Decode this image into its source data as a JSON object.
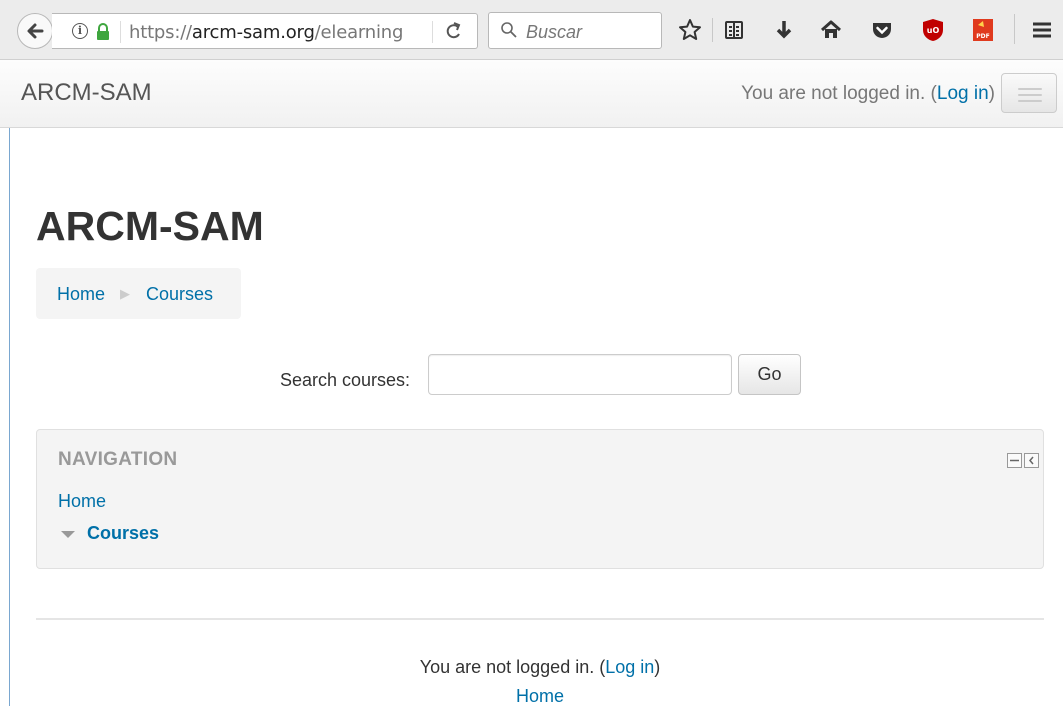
{
  "browser": {
    "url_prefix": "https://",
    "url_domain": "arcm-sam.org",
    "url_path": "/elearning",
    "search_placeholder": "Buscar",
    "pdf_label": "PDF",
    "ublock_label": "uO"
  },
  "site": {
    "brand": "ARCM-SAM",
    "login_status": "You are not logged in.",
    "login_link": "Log in"
  },
  "page": {
    "title": "ARCM-SAM"
  },
  "breadcrumb": {
    "items": [
      "Home",
      "Courses"
    ]
  },
  "search": {
    "label": "Search courses:",
    "value": "",
    "button": "Go"
  },
  "navigation_block": {
    "title": "NAVIGATION",
    "items": [
      "Home",
      "Courses"
    ]
  },
  "footer": {
    "login_status": "You are not logged in.",
    "login_link": "Log in",
    "home_link": "Home"
  },
  "colors": {
    "link": "#0070a8",
    "ublock": "#c00000",
    "pdf": "#e03a1e"
  }
}
